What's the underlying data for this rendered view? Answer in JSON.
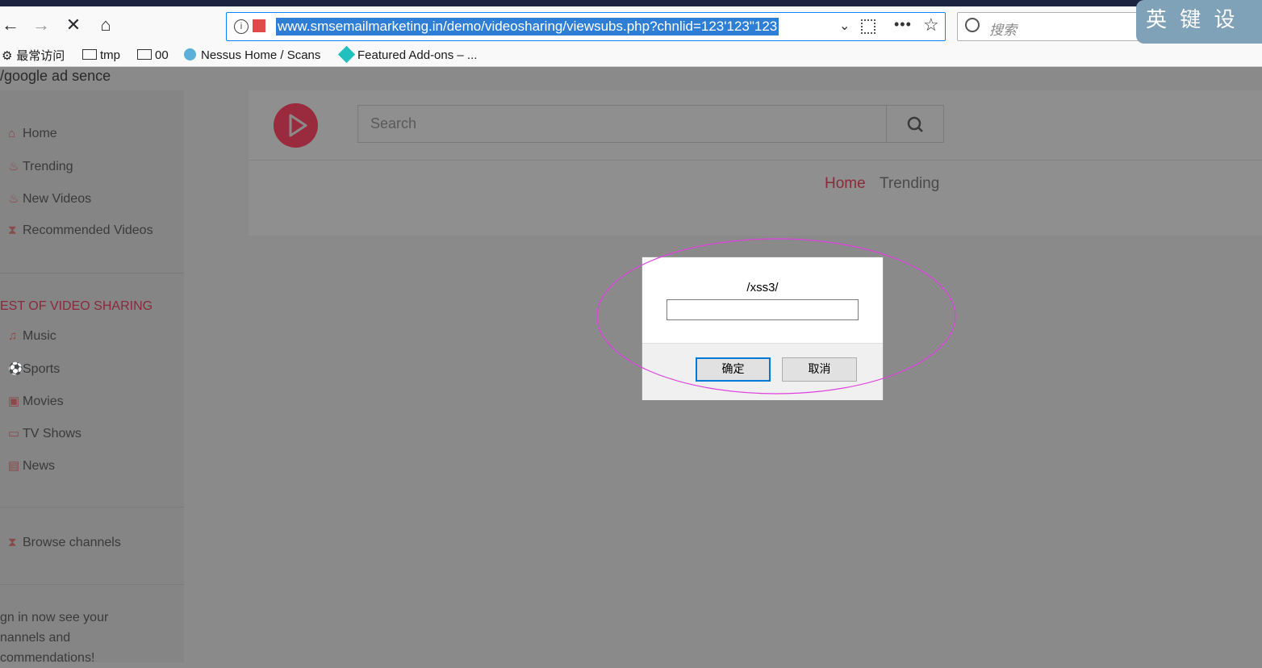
{
  "browser": {
    "back_glyph": "←",
    "forward_glyph": "→",
    "stop_glyph": "✕",
    "home_glyph": "⌂",
    "url": "www.smsemailmarketing.in/demo/videosharing/viewsubs.php?chnlid=123'123\"123",
    "search_placeholder": "搜索",
    "ime_text": "英 键 设",
    "bookmarks": [
      {
        "label": "最常访问",
        "icon": "gear-icon"
      },
      {
        "label": "tmp",
        "icon": "folder-icon"
      },
      {
        "label": "00",
        "icon": "folder-icon"
      },
      {
        "label": "Nessus Home / Scans",
        "icon": "nessus-icon"
      },
      {
        "label": "Featured Add-ons – ...",
        "icon": "addon-icon"
      }
    ]
  },
  "page": {
    "ad_text": "/google ad sence",
    "sidebar": {
      "nav": [
        "Home",
        "Trending",
        "New Videos",
        "Recommended Videos"
      ],
      "section_title": "EST OF VIDEO SHARING",
      "categories": [
        "Music",
        "Sports",
        "Movies",
        "TV Shows",
        "News"
      ],
      "browse": "Browse channels",
      "signin_lines": [
        "gn in now see your",
        "nannels and",
        "commendations!"
      ]
    },
    "header": {
      "search_placeholder": "Search",
      "tabs": [
        "Home",
        "Trending"
      ]
    }
  },
  "dialog": {
    "message": "/xss3/",
    "ok_label": "确定",
    "cancel_label": "取消"
  },
  "colors": {
    "accent_red": "#9a2b3e",
    "url_highlight": "#2e7ed6",
    "annotation_ellipse": "#e040e0"
  }
}
